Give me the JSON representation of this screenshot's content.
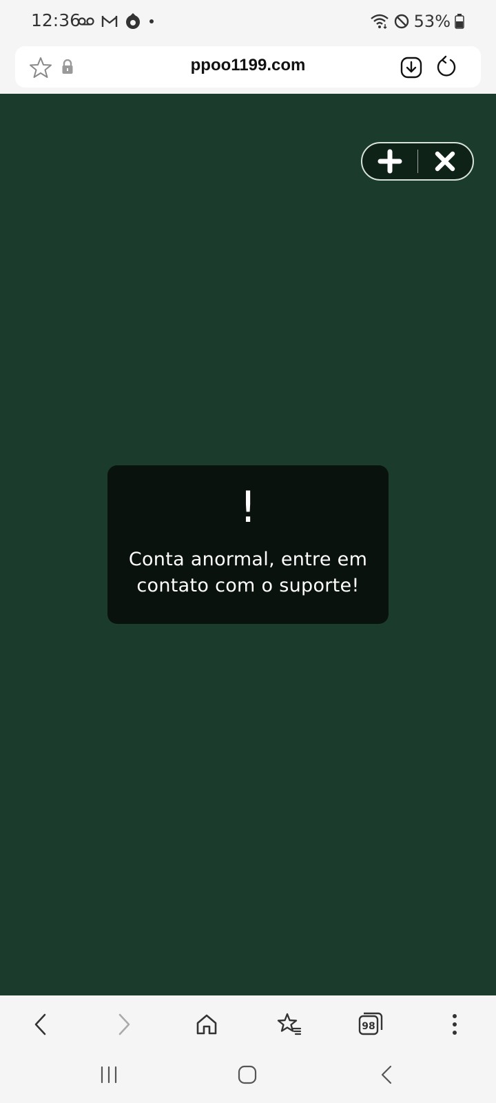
{
  "status_bar": {
    "time": "12:36",
    "battery": "53%"
  },
  "browser": {
    "url": "ppoo1199.com"
  },
  "page": {
    "background_color": "#1b3c2c",
    "dialog": {
      "icon_text": "!",
      "message": "Conta anormal, entre em contato com o suporte!"
    }
  },
  "toolbar": {
    "tabs_count": "98"
  }
}
